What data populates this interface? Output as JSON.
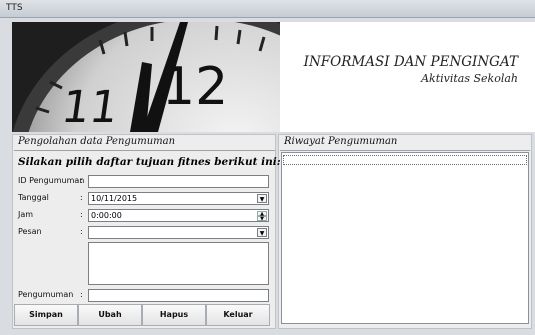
{
  "window": {
    "title": "TTS"
  },
  "header": {
    "clock_numbers": [
      "11",
      "12"
    ],
    "title": "INFORMASI DAN PENGINGAT",
    "subtitle": "Aktivitas Sekolah"
  },
  "form_panel": {
    "title": "Pengolahan data Pengumuman",
    "instruction": "Silakan pilih daftar tujuan fitnes berikut ini:",
    "fields": {
      "id": {
        "label": "ID Pengumuman",
        "value": ""
      },
      "tanggal": {
        "label": "Tanggal",
        "value": "10/11/2015"
      },
      "jam": {
        "label": "Jam",
        "value": "0:00:00"
      },
      "pesan": {
        "label": "Pesan",
        "value": ""
      },
      "pengumuman": {
        "label": "Pengumuman",
        "value": ""
      }
    },
    "buttons": {
      "simpan": "Simpan",
      "ubah": "Ubah",
      "hapus": "Hapus",
      "keluar": "Keluar"
    }
  },
  "history_panel": {
    "title": "Riwayat Pengumuman"
  }
}
